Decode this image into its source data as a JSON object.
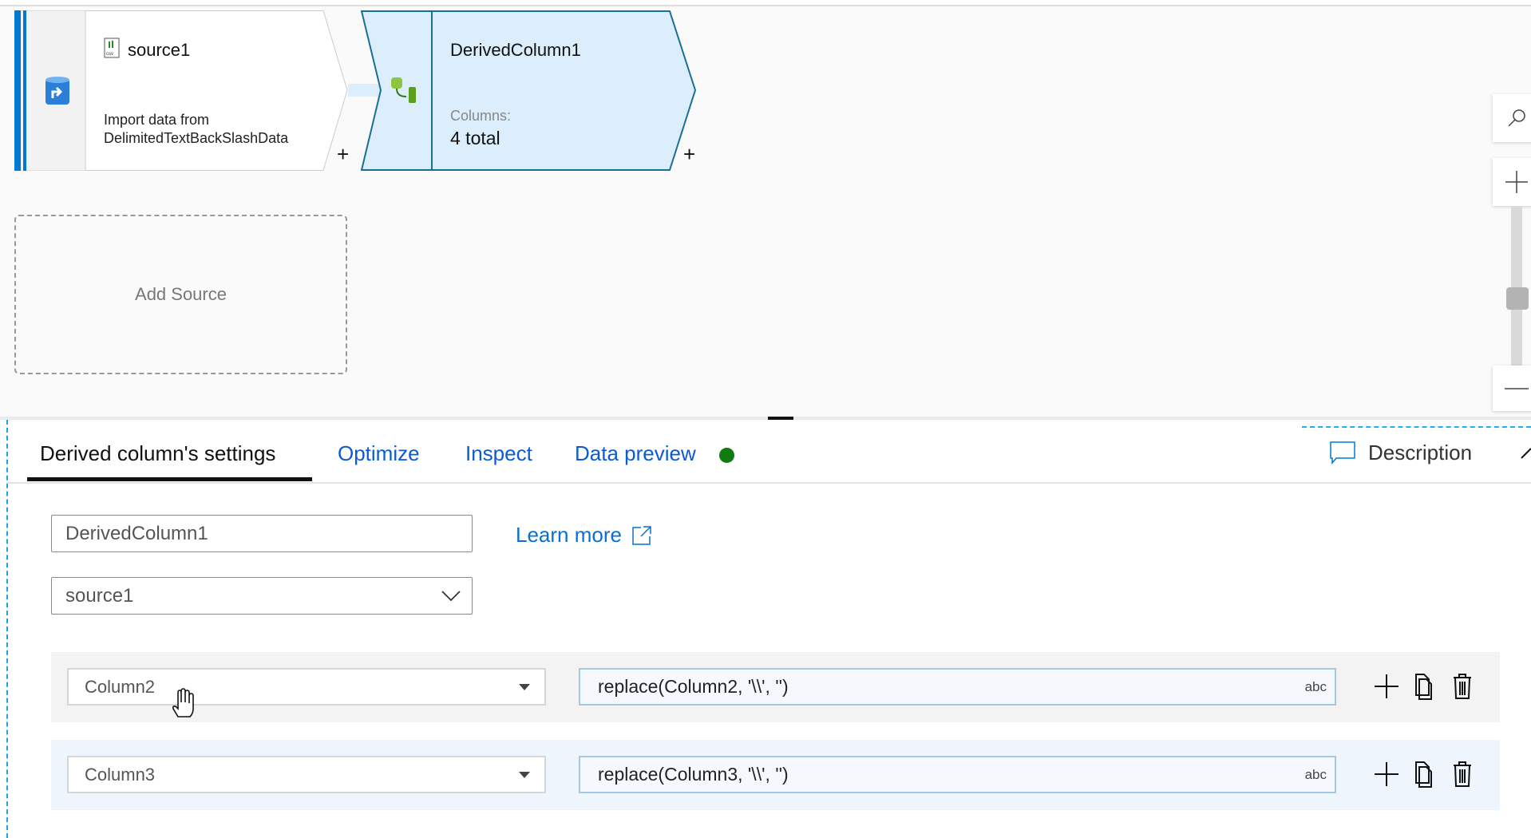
{
  "canvas": {
    "source_node": {
      "title": "source1",
      "description_line1": "Import data from",
      "description_line2": "DelimitedTextBackSlashData",
      "icon": "database-source-icon",
      "file_icon": "csv-file-icon"
    },
    "derived_node": {
      "title": "DerivedColumn1",
      "columns_label": "Columns:",
      "columns_value": "4 total",
      "icon": "derived-column-icon"
    },
    "add_source_label": "Add Source",
    "add_label": "+"
  },
  "tabs": [
    {
      "label": "Derived column's settings",
      "active": true
    },
    {
      "label": "Optimize"
    },
    {
      "label": "Inspect"
    },
    {
      "label": "Data preview",
      "status_color": "#107c10"
    }
  ],
  "description_label": "Description",
  "settings": {
    "name_value": "DerivedColumn1",
    "learn_more": "Learn more",
    "incoming_stream": "source1",
    "columns": [
      {
        "column": "Column2",
        "expression": "replace(Column2, '\\\\', '')",
        "type": "abc"
      },
      {
        "column": "Column3",
        "expression": "replace(Column3, '\\\\', '')",
        "type": "abc"
      }
    ]
  },
  "colors": {
    "accent": "#0078d4",
    "node_selected": "#dcedfb",
    "node_border": "#1a6f94"
  }
}
